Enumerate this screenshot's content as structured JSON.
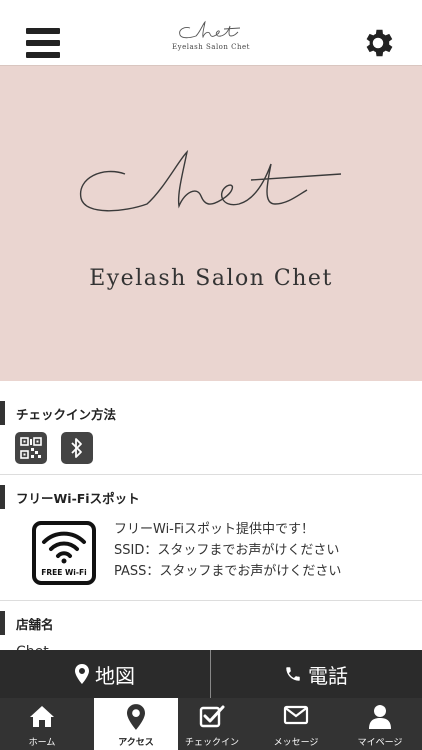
{
  "header": {
    "logo_subtitle": "Eyelash Salon Chet"
  },
  "hero": {
    "title": "Eyelash Salon Chet"
  },
  "checkin_section": {
    "title": "チェックイン方法",
    "icons": [
      "qr-code-icon",
      "bluetooth-icon"
    ]
  },
  "wifi_section": {
    "title": "フリーWi-Fiスポット",
    "badge_label": "FREE Wi-Fi",
    "line1": "フリーWi-Fiスポット提供中です！",
    "line2": "SSID：スタッフまでお声がけください",
    "line3": "PASS：スタッフまでお声がけください"
  },
  "store_section": {
    "title": "店舗名",
    "peek_text": "Chet"
  },
  "map_bar": {
    "map_label": "地図",
    "phone_label": "電話"
  },
  "tabs": [
    {
      "label": "ホーム",
      "icon": "home-icon"
    },
    {
      "label": "アクセス",
      "icon": "location-pin-icon"
    },
    {
      "label": "チェックイン",
      "icon": "checkbox-icon"
    },
    {
      "label": "メッセージ",
      "icon": "envelope-icon"
    },
    {
      "label": "マイページ",
      "icon": "user-icon"
    }
  ],
  "colors": {
    "hero_bg": "#ead5d0",
    "bar_dark": "#2b2b2b",
    "tab_bg": "#333333"
  }
}
